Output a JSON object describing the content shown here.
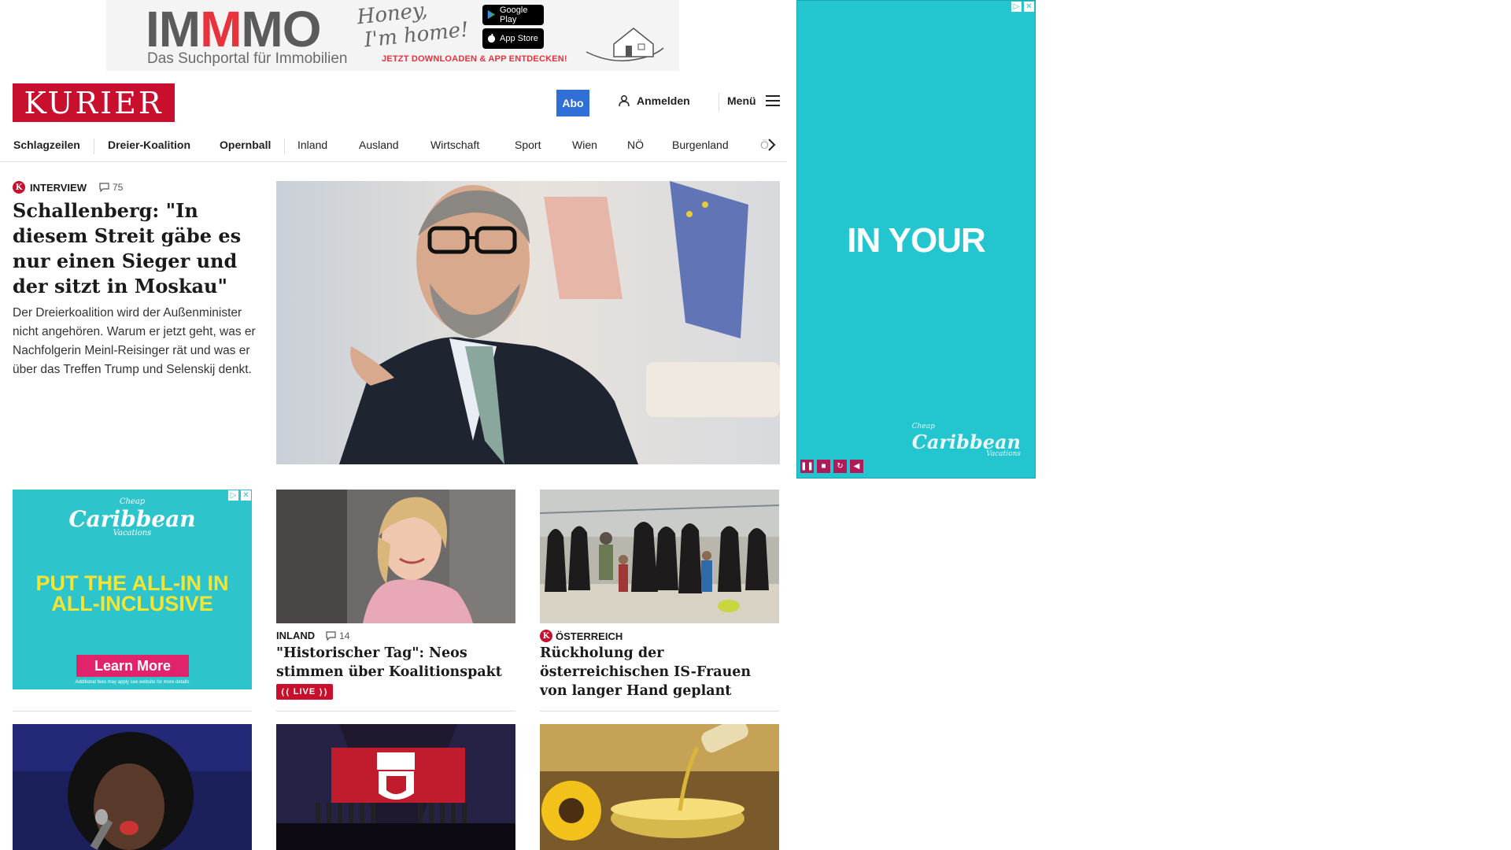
{
  "top_ad": {
    "brand_prefix": "IM",
    "brand_accent": "M",
    "brand_suffix": "MO",
    "tagline": "Das Suchportal für Immobilien",
    "script_line1": "Honey,",
    "script_line2": "I'm home!",
    "google_play": "Google Play",
    "app_store": "App Store",
    "cta": "JETZT DOWNLOADEN & APP ENTDECKEN!"
  },
  "header": {
    "brand": "KURIER",
    "abo": "Abo",
    "login": "Anmelden",
    "menu": "Menü"
  },
  "nav": {
    "items": [
      "Schlagzeilen",
      "Dreier-Koalition",
      "Opernball",
      "Inland",
      "Ausland",
      "Wirtschaft",
      "Sport",
      "Wien",
      "NÖ",
      "Burgenland",
      "Ö"
    ]
  },
  "hero": {
    "badge": "K",
    "category": "INTERVIEW",
    "comments": "75",
    "title": "Schallenberg: \"In diesem Streit gäbe es nur einen Sieger und der sitzt in Moskau\"",
    "teaser": "Der Dreierkoalition wird der Außenminister nicht angehören. Warum er jetzt geht, was er Nachfolgerin Meinl-Reisinger rät und was er über das Treffen Trump und Selenskij denkt."
  },
  "mid_ad": {
    "brand_top": "Cheap",
    "brand": "Caribbean",
    "brand_sub": "Vacations",
    "headline_1": "PUT THE ALL-IN IN",
    "headline_2": "ALL-INCLUSIVE",
    "button": "Learn More",
    "fine": "Additional fees may apply see website for more details"
  },
  "cards": [
    {
      "category": "INLAND",
      "comments": "14",
      "title": "\"Historischer Tag\": Neos stimmen über Koalitionspakt ab",
      "live": "LIVE"
    },
    {
      "badge": "K",
      "category": "ÖSTERREICH",
      "title": "Rückholung der österreichischen IS-Frauen von langer Hand geplant"
    }
  ],
  "side_ad": {
    "big": "IN YOUR",
    "brand_top": "Cheap",
    "brand": "Caribbean",
    "brand_sub": "Vacations"
  },
  "colors": {
    "brand_red": "#c8102e",
    "abo_blue": "#2f6fd6",
    "ad_teal": "#23c5cf",
    "ad_yellow": "#f5e532",
    "ad_pink": "#e1236b"
  }
}
